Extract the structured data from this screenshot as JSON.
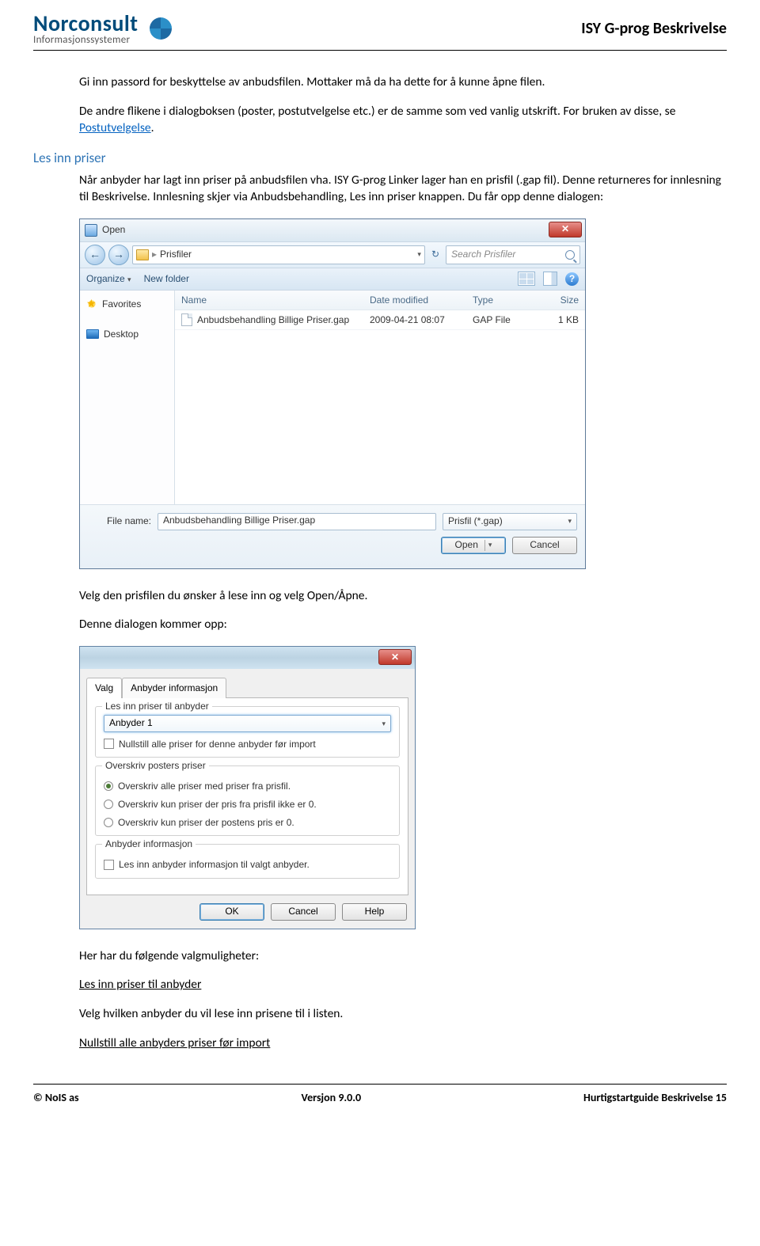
{
  "header": {
    "logo_main": "Norconsult",
    "logo_sub": "Informasjonssystemer",
    "title": "ISY G-prog Beskrivelse"
  },
  "intro": {
    "p1": "Gi inn passord for beskyttelse av anbudsfilen. Mottaker må da ha dette for å kunne åpne filen.",
    "p2a": "De andre flikene i dialogboksen (poster, postutvelgelse etc.) er de samme som ved vanlig utskrift. For bruken av disse, se ",
    "p2_link": "Postutvelgelse",
    "p2b": "."
  },
  "section_heading": "Les inn priser",
  "section_p": "Når anbyder har lagt inn priser på anbudsfilen vha. ISY G-prog Linker lager han en prisfil (.gap fil). Denne returneres for innlesning til Beskrivelse. Innlesning skjer via Anbudsbehandling, Les inn priser knappen. Du får opp denne dialogen:",
  "opendlg": {
    "title": "Open",
    "path": "Prisfiler",
    "search_placeholder": "Search Prisfiler",
    "organize": "Organize",
    "newfolder": "New folder",
    "side_fav": "Favorites",
    "side_desktop": "Desktop",
    "col_name": "Name",
    "col_date": "Date modified",
    "col_type": "Type",
    "col_size": "Size",
    "row": {
      "name": "Anbudsbehandling Billige Priser.gap",
      "date": "2009-04-21 08:07",
      "type": "GAP File",
      "size": "1 KB"
    },
    "filename_label": "File name:",
    "filename_value": "Anbudsbehandling Billige Priser.gap",
    "filetype": "Prisfil (*.gap)",
    "open_btn": "Open",
    "cancel_btn": "Cancel"
  },
  "after_open1": "Velg den prisfilen du ønsker å lese inn og velg Open/Åpne.",
  "after_open2": "Denne dialogen kommer opp:",
  "importdlg": {
    "tab1": "Valg",
    "tab2": "Anbyder informasjon",
    "g1_legend": "Les inn priser til anbyder",
    "anbyder": "Anbyder 1",
    "chk1": "Nullstill alle priser for denne anbyder før import",
    "g2_legend": "Overskriv posters priser",
    "r1": "Overskriv alle priser med priser fra prisfil.",
    "r2": "Overskriv kun priser der pris fra prisfil ikke er 0.",
    "r3": "Overskriv kun priser der postens pris er 0.",
    "g3_legend": "Anbyder informasjon",
    "chk2": "Les inn anbyder informasjon til valgt anbyder.",
    "ok": "OK",
    "cancel": "Cancel",
    "help": "Help"
  },
  "trailing": {
    "p1": "Her har du følgende valgmuligheter:",
    "p2": "Les inn priser til anbyder",
    "p3": "Velg hvilken anbyder du vil lese inn prisene til i listen.",
    "p4": "Nullstill alle anbyders priser før import"
  },
  "footer": {
    "left": "© NoIS as",
    "center": "Versjon 9.0.0",
    "right": "Hurtigstartguide Beskrivelse 15"
  }
}
